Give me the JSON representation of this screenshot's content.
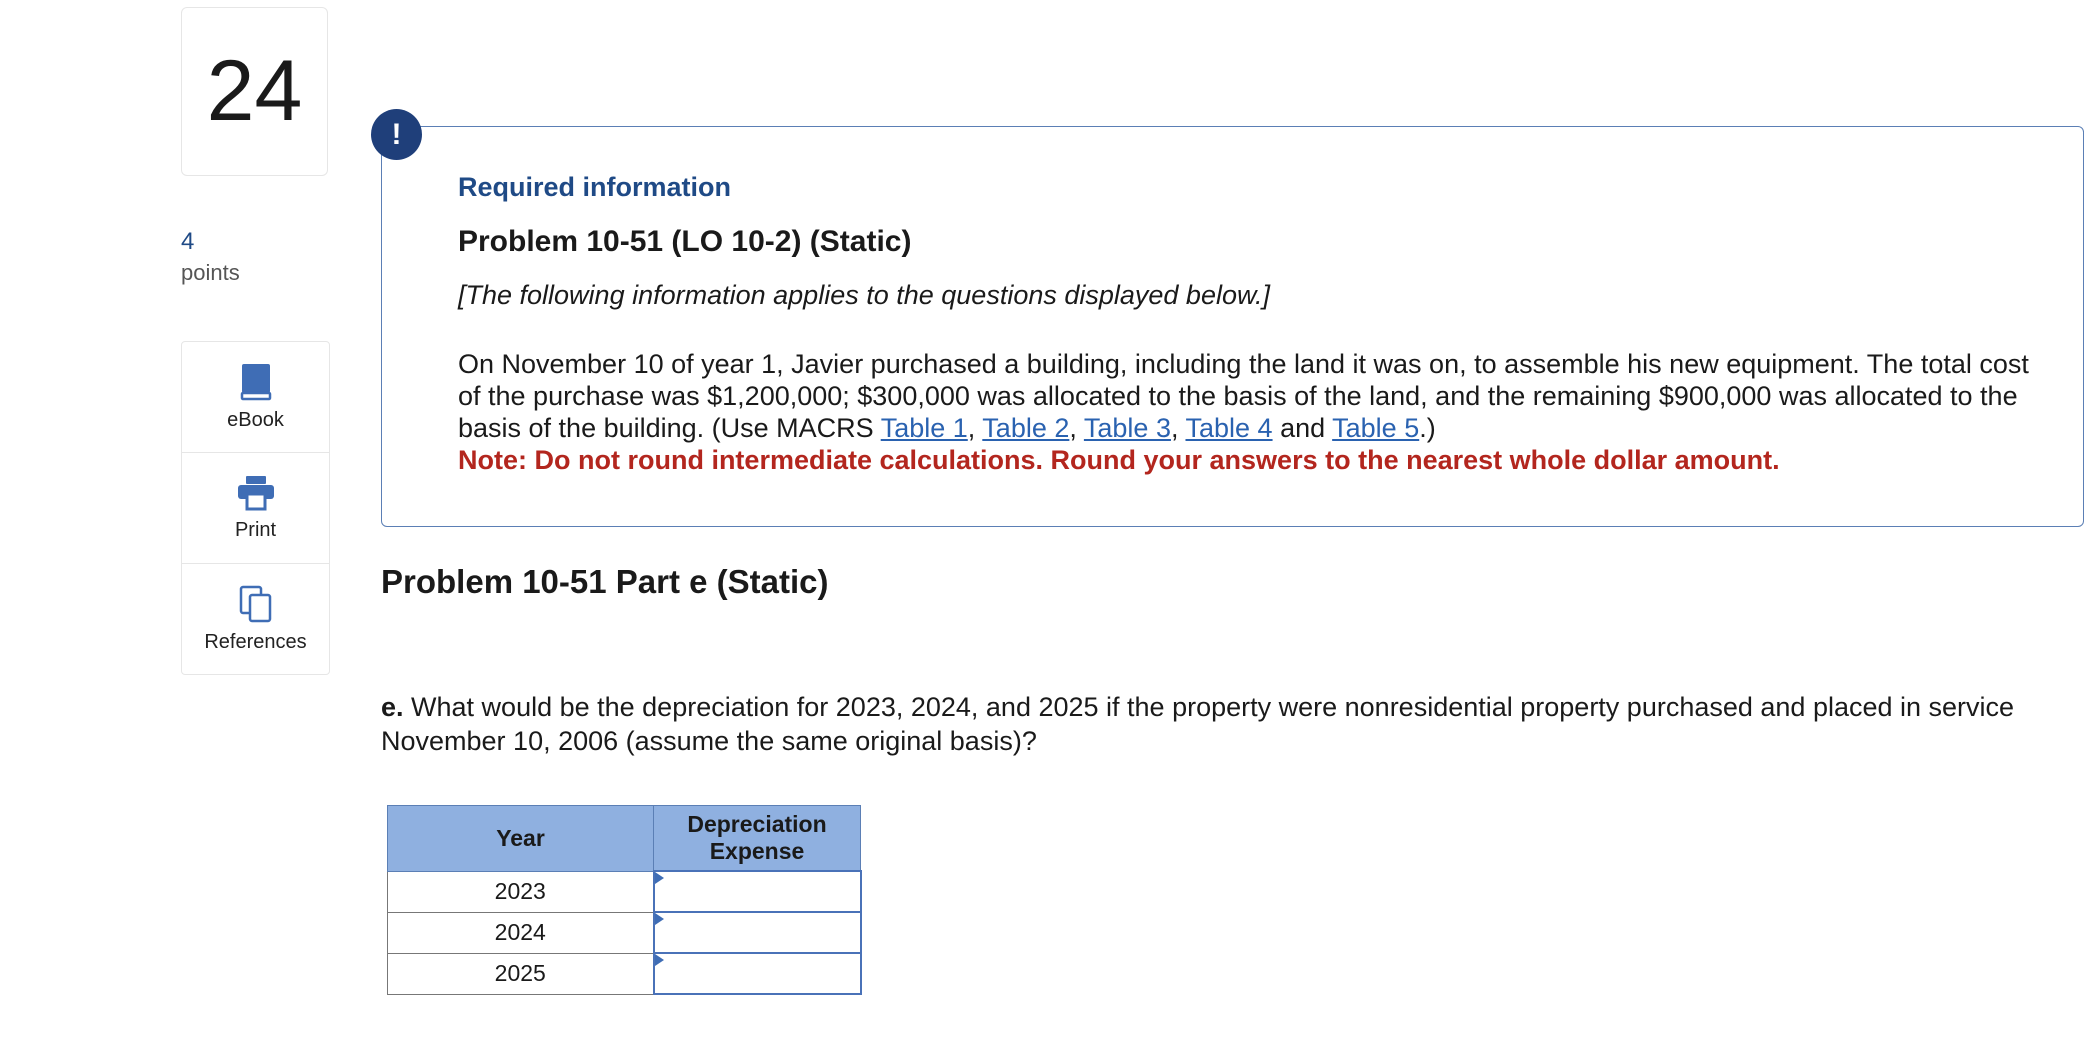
{
  "question_number": "24",
  "points": {
    "value": "4",
    "label": "points"
  },
  "tools": [
    {
      "label": "eBook",
      "icon": "book-icon"
    },
    {
      "label": "Print",
      "icon": "printer-icon"
    },
    {
      "label": "References",
      "icon": "copy-icon"
    }
  ],
  "alert_icon": "!",
  "info": {
    "heading": "Required information",
    "problem_title": "Problem 10-51 (LO 10-2) (Static)",
    "note": "[The following information applies to the questions displayed below.]",
    "body_prefix": "On November 10 of year 1, Javier purchased a building, including the land it was on, to assemble his new equipment. The total cost of the purchase was $1,200,000; $300,000 was allocated to the basis of the land, and the remaining $900,000 was allocated to the basis of the building. (Use MACRS ",
    "links": [
      "Table 1",
      "Table 2",
      "Table 3",
      "Table 4",
      "Table 5"
    ],
    "sep_comma": ", ",
    "sep_and": " and ",
    "body_suffix": ".)",
    "warning": "Note: Do not round intermediate calculations. Round your answers to the nearest whole dollar amount."
  },
  "part": {
    "title": "Problem 10-51 Part e (Static)",
    "question_label": "e.",
    "question_text": " What would be the depreciation for 2023, 2024, and 2025 if the property were nonresidential property purchased and placed in service November 10, 2006 (assume the same original basis)?"
  },
  "table": {
    "headers": [
      "Year",
      "Depreciation Expense"
    ],
    "rows": [
      {
        "year": "2023",
        "value": ""
      },
      {
        "year": "2024",
        "value": ""
      },
      {
        "year": "2025",
        "value": ""
      }
    ]
  },
  "colors": {
    "accent": "#1f4a86",
    "link": "#2a62b0",
    "warning": "#b3261e",
    "table_header": "#8fb0e0"
  }
}
